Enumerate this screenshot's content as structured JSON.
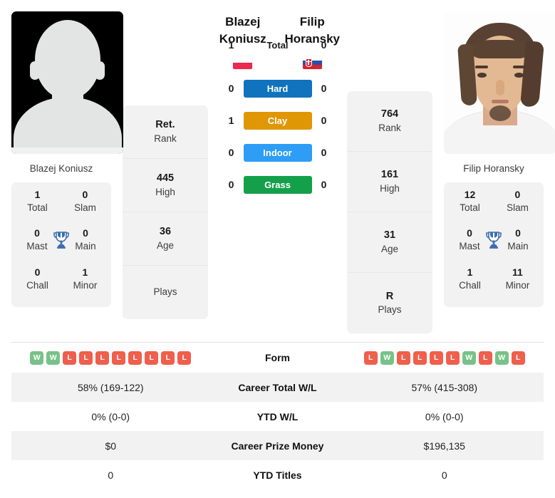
{
  "players": {
    "left": {
      "first_name": "Blazej",
      "last_name": "Koniusz",
      "full_name": "Blazej Koniusz",
      "photo_type": "placeholder-silhouette",
      "flag": "poland-flag",
      "rank": "Ret.",
      "rank_label": "Rank",
      "high": "445",
      "high_label": "High",
      "age": "36",
      "age_label": "Age",
      "plays": "",
      "plays_label": "Plays",
      "titles": {
        "total": "1",
        "total_label": "Total",
        "slam": "0",
        "slam_label": "Slam",
        "mast": "0",
        "mast_label": "Mast",
        "main": "0",
        "main_label": "Main",
        "chall": "0",
        "chall_label": "Chall",
        "minor": "1",
        "minor_label": "Minor"
      },
      "form": [
        "W",
        "W",
        "L",
        "L",
        "L",
        "L",
        "L",
        "L",
        "L",
        "L"
      ],
      "career_total_wl": "58% (169-122)",
      "ytd_wl": "0% (0-0)",
      "career_prize_money": "$0",
      "ytd_titles": "0"
    },
    "right": {
      "first_name": "Filip",
      "last_name": "Horansky",
      "full_name": "Filip Horansky",
      "photo_type": "portrait-photo",
      "flag": "slovakia-flag",
      "rank": "764",
      "rank_label": "Rank",
      "high": "161",
      "high_label": "High",
      "age": "31",
      "age_label": "Age",
      "plays": "R",
      "plays_label": "Plays",
      "titles": {
        "total": "12",
        "total_label": "Total",
        "slam": "0",
        "slam_label": "Slam",
        "mast": "0",
        "mast_label": "Mast",
        "main": "0",
        "main_label": "Main",
        "chall": "1",
        "chall_label": "Chall",
        "minor": "11",
        "minor_label": "Minor"
      },
      "form": [
        "L",
        "W",
        "L",
        "L",
        "L",
        "L",
        "W",
        "L",
        "W",
        "L"
      ],
      "career_total_wl": "57% (415-308)",
      "ytd_wl": "0% (0-0)",
      "career_prize_money": "$196,135",
      "ytd_titles": "0"
    }
  },
  "h2h": {
    "rows": [
      {
        "label": "Total",
        "left": "1",
        "right": "0",
        "color": ""
      },
      {
        "label": "Hard",
        "left": "0",
        "right": "0",
        "color": "#1073bd"
      },
      {
        "label": "Clay",
        "left": "1",
        "right": "0",
        "color": "#e09706"
      },
      {
        "label": "Indoor",
        "left": "0",
        "right": "0",
        "color": "#2e9df5"
      },
      {
        "label": "Grass",
        "left": "0",
        "right": "0",
        "color": "#14a04a"
      }
    ]
  },
  "table": {
    "rows": [
      {
        "label": "Form",
        "type": "form"
      },
      {
        "label": "Career Total W/L",
        "type": "text",
        "left": "58% (169-122)",
        "right": "57% (415-308)"
      },
      {
        "label": "YTD W/L",
        "type": "text",
        "left": "0% (0-0)",
        "right": "0% (0-0)"
      },
      {
        "label": "Career Prize Money",
        "type": "text",
        "left": "$0",
        "right": "$196,135"
      },
      {
        "label": "YTD Titles",
        "type": "text",
        "left": "0",
        "right": "0"
      }
    ]
  },
  "colors": {
    "hard": "#1073bd",
    "clay": "#e09706",
    "indoor": "#2e9df5",
    "grass": "#14a04a",
    "win_badge": "#78c288",
    "loss_badge": "#ef5f4c",
    "trophy": "#3d6fae",
    "card_bg": "#f2f2f2"
  }
}
